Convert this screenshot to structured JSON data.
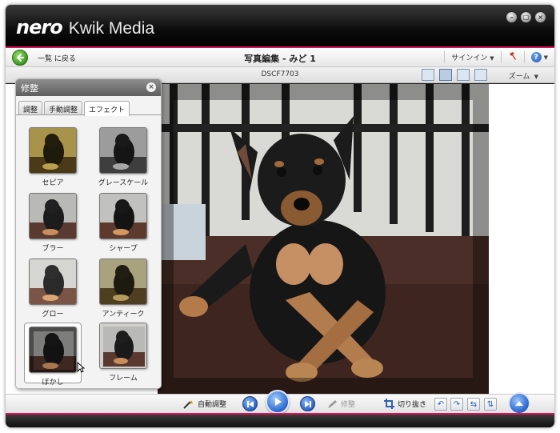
{
  "window": {
    "brand": "nero",
    "app_name": "Kwik Media",
    "controls": [
      {
        "name": "minimize-button",
        "glyph": "–"
      },
      {
        "name": "restore-button",
        "glyph": "▢"
      },
      {
        "name": "close-button",
        "glyph": "×"
      }
    ]
  },
  "nav": {
    "back_label": "一覧 に戻る",
    "title": "写真編集 - みど 1",
    "sign_in": "サインイン",
    "tools_icon": "hammer-icon",
    "help_icon": "help-icon",
    "help_glyph": "?"
  },
  "subbar": {
    "filename": "DSCF7703",
    "view_modes": [
      "single-view-icon",
      "compare-view-icon",
      "actual-size-icon",
      "fit-view-icon"
    ],
    "zoom_label": "ズーム"
  },
  "panel": {
    "title": "修整",
    "tabs": [
      {
        "label": "調整",
        "active": false
      },
      {
        "label": "手動調整",
        "active": false
      },
      {
        "label": "エフェクト",
        "active": true
      }
    ],
    "effects": [
      {
        "label": "セピア",
        "tint": "#8a7a35"
      },
      {
        "label": "グレースケール",
        "tint": "#6a6a6a"
      },
      {
        "label": "ブラー",
        "tint": "#6b4a3a"
      },
      {
        "label": "シャープ",
        "tint": "#6e4a36"
      },
      {
        "label": "グロー",
        "tint": "#7a5a45"
      },
      {
        "label": "アンティーク",
        "tint": "#6a5a30"
      },
      {
        "label": "ぼかし",
        "tint": "#5a4034",
        "selected": true
      },
      {
        "label": "フレーム",
        "tint": "#6b4c3a"
      }
    ]
  },
  "bottom": {
    "auto_adjust": "自動調整",
    "retouch": "修整",
    "crop": "切り抜き"
  },
  "colors": {
    "accent": "#d8135a",
    "button_blue": "#2a62c8",
    "back_green": "#3a9a1f"
  }
}
